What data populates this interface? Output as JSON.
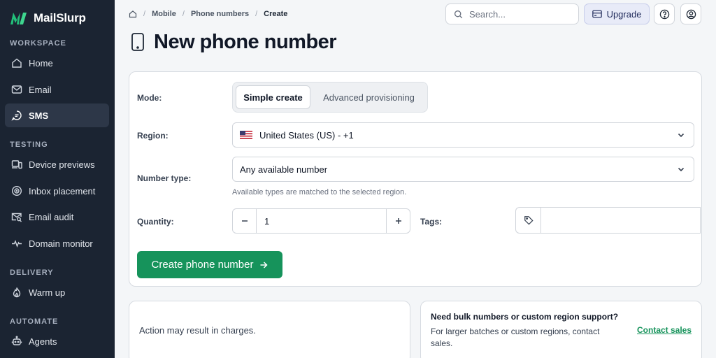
{
  "brand": {
    "name": "MailSlurp",
    "accent": "#22c07a"
  },
  "sidebar": {
    "sections": [
      {
        "title": "WORKSPACE"
      },
      {
        "title": "TESTING"
      },
      {
        "title": "DELIVERY"
      },
      {
        "title": "AUTOMATE"
      }
    ],
    "items": [
      {
        "label": "Home",
        "icon": "home-icon"
      },
      {
        "label": "Email",
        "icon": "mail-icon"
      },
      {
        "label": "SMS",
        "icon": "chat-icon",
        "active": true
      },
      {
        "label": "Device previews",
        "icon": "devices-icon"
      },
      {
        "label": "Inbox placement",
        "icon": "target-icon"
      },
      {
        "label": "Email audit",
        "icon": "mail-search-icon"
      },
      {
        "label": "Domain monitor",
        "icon": "pulse-icon"
      },
      {
        "label": "Warm up",
        "icon": "flame-icon"
      },
      {
        "label": "Agents",
        "icon": "robot-icon"
      }
    ]
  },
  "breadcrumb": {
    "items": [
      "Mobile",
      "Phone numbers"
    ],
    "current": "Create"
  },
  "header": {
    "search_placeholder": "Search...",
    "upgrade_label": "Upgrade"
  },
  "page": {
    "title": "New phone number"
  },
  "form": {
    "mode_label": "Mode:",
    "mode_options": [
      "Simple create",
      "Advanced provisioning"
    ],
    "mode_selected": "Simple create",
    "region_label": "Region:",
    "region_value": "United States (US) - +1",
    "number_type_label": "Number type:",
    "number_type_value": "Any available number",
    "number_type_hint": "Available types are matched to the selected region.",
    "quantity_label": "Quantity:",
    "quantity_value": "1",
    "tags_label": "Tags:",
    "tags_value": "",
    "submit_label": "Create phone number"
  },
  "footer": {
    "charges_note": "Action may result in charges.",
    "bulk_title": "Need bulk numbers or custom region support?",
    "bulk_body": "For larger batches or custom regions, contact sales.",
    "contact_label": "Contact sales"
  }
}
